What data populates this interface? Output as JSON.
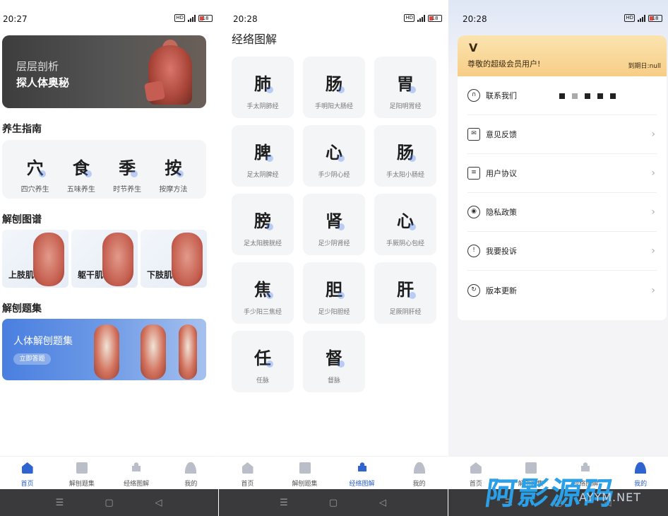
{
  "panel1": {
    "status_time": "20:27",
    "battery": "18",
    "banner": {
      "line1": "层层剖析",
      "line2": "探人体奥秘"
    },
    "section_guide": "养生指南",
    "guide_items": [
      {
        "char": "穴",
        "label": "四穴养生"
      },
      {
        "char": "食",
        "label": "五味养生"
      },
      {
        "char": "季",
        "label": "时节养生"
      },
      {
        "char": "按",
        "label": "按摩方法"
      }
    ],
    "section_atlas": "解刨图谱",
    "atlas_items": [
      "上肢肌",
      "躯干肌",
      "下肢肌"
    ],
    "section_quiz": "解刨题集",
    "quiz": {
      "title": "人体解刨题集",
      "button": "立即答题"
    }
  },
  "panel2": {
    "status_time": "20:28",
    "battery": "18",
    "title": "经络图解",
    "meridians": [
      {
        "char": "肺",
        "label": "手太阴肺经"
      },
      {
        "char": "肠",
        "label": "手明阳大肠经"
      },
      {
        "char": "胃",
        "label": "足阳明胃经"
      },
      {
        "char": "脾",
        "label": "足太阴脾经"
      },
      {
        "char": "心",
        "label": "手少阴心经"
      },
      {
        "char": "肠",
        "label": "手太阳小肠经"
      },
      {
        "char": "膀",
        "label": "足太阳膀胱经"
      },
      {
        "char": "肾",
        "label": "足少阴肾经"
      },
      {
        "char": "心",
        "label": "手厥阴心包经"
      },
      {
        "char": "焦",
        "label": "手少阳三焦经"
      },
      {
        "char": "胆",
        "label": "足少阳胆经"
      },
      {
        "char": "肝",
        "label": "足厥阴肝经"
      },
      {
        "char": "任",
        "label": "任脉"
      },
      {
        "char": "督",
        "label": "督脉"
      }
    ]
  },
  "panel3": {
    "status_time": "20:28",
    "battery": "18",
    "vip": {
      "badge": "V",
      "message": "尊敬的超级会员用户!",
      "expiry": "到期日:null"
    },
    "menu": [
      {
        "icon": "headset-icon",
        "label": "联系我们"
      },
      {
        "icon": "mail-icon",
        "label": "意见反馈"
      },
      {
        "icon": "document-icon",
        "label": "用户协议"
      },
      {
        "icon": "privacy-icon",
        "label": "隐私政策"
      },
      {
        "icon": "info-icon",
        "label": "我要投诉"
      },
      {
        "icon": "update-icon",
        "label": "版本更新"
      }
    ]
  },
  "tabbar": [
    "首页",
    "解刨题集",
    "经络图解",
    "我的"
  ],
  "tabbar_active": [
    0,
    2,
    3
  ],
  "watermark": {
    "main": "阿影源码",
    "sub": "AYYM.NET"
  },
  "colors": {
    "accent": "#2f63cf",
    "vip_gold": "#f7cd86",
    "quiz_blue": "#4a7fe0"
  }
}
